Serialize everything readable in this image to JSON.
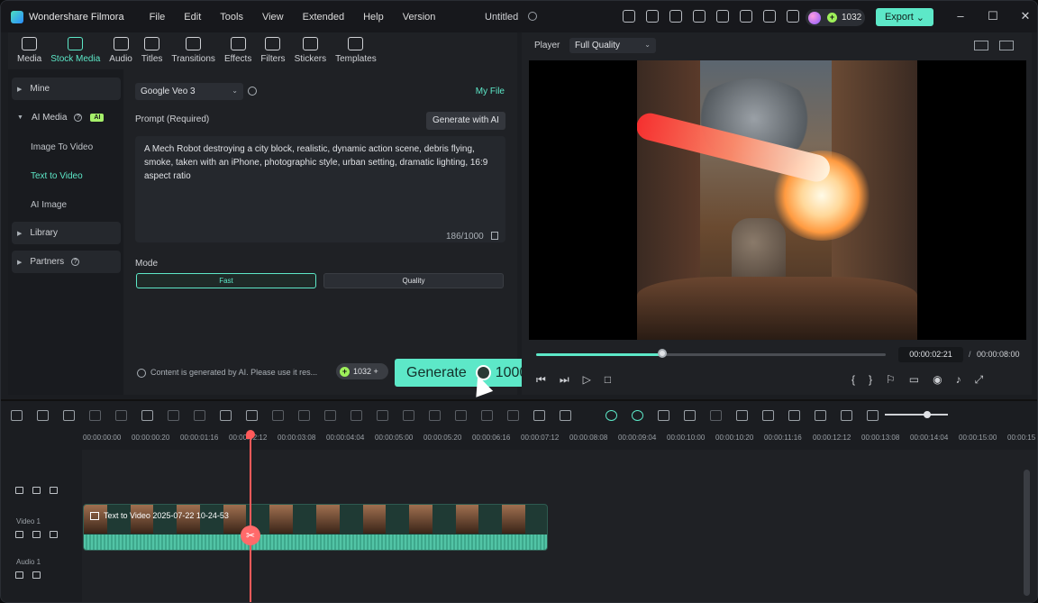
{
  "app": {
    "name": "Wondershare Filmora",
    "doc_title": "Untitled"
  },
  "menu": [
    "File",
    "Edit",
    "Tools",
    "View",
    "Extended",
    "Help",
    "Version"
  ],
  "titlebar": {
    "credits": "1032",
    "export_label": "Export",
    "coin_symbol": "+"
  },
  "tabs": [
    "Media",
    "Stock Media",
    "Audio",
    "Titles",
    "Transitions",
    "Effects",
    "Filters",
    "Stickers",
    "Templates"
  ],
  "sidebar": {
    "mine": "Mine",
    "ai_media": "AI Media",
    "ai_badge": "AI",
    "items": [
      "Image To Video",
      "Text to Video",
      "AI Image"
    ],
    "library": "Library",
    "partners": "Partners"
  },
  "form": {
    "model": "Google Veo 3",
    "my_file": "My File",
    "prompt_label": "Prompt (Required)",
    "generate_with_ai": "Generate with AI",
    "prompt_text": "A Mech Robot destroying a city block, realistic, dynamic action scene, debris flying, smoke, taken with an iPhone, photographic style, urban setting, dramatic lighting, 16:9 aspect ratio",
    "char_count": "186/1000",
    "mode_label": "Mode",
    "mode_fast": "Fast",
    "mode_quality": "Quality",
    "notice": "Content is generated by AI. Please use it res...",
    "cost_pill": "1032",
    "generate_label": "Generate",
    "generate_cost": "1000"
  },
  "player": {
    "label": "Player",
    "quality": "Full Quality",
    "current_time": "00:00:02:21",
    "separator": "/",
    "total_time": "00:00:08:00",
    "progress": 0.36
  },
  "timeline": {
    "ruler": [
      "00:00:00:00",
      "00:00:00:20",
      "00:00:01:16",
      "00:00:02:12",
      "00:00:03:08",
      "00:00:04:04",
      "00:00:05:00",
      "00:00:05:20",
      "00:00:06:16",
      "00:00:07:12",
      "00:00:08:08",
      "00:00:09:04",
      "00:00:10:00",
      "00:00:10:20",
      "00:00:11:16",
      "00:00:12:12",
      "00:00:13:08",
      "00:00:14:04",
      "00:00:15:00",
      "00:00:15"
    ],
    "video_track": "Video 1",
    "audio_track": "Audio 1",
    "clip_title": "Text to Video 2025-07-22 10-24-53"
  }
}
